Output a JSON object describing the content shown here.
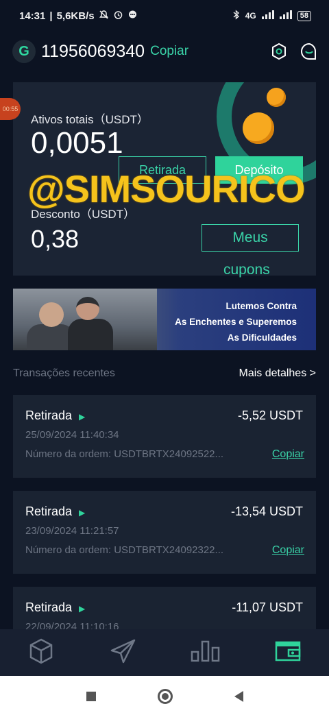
{
  "status_bar": {
    "time": "14:31",
    "speed": "5,6KB/s",
    "network": "4G",
    "battery": "58"
  },
  "header": {
    "logo_letter": "G",
    "account": "11956069340",
    "copy_label": "Copiar"
  },
  "timer_badge": "00:55",
  "balance": {
    "total_label": "Ativos totais（USDT）",
    "total_value": "0,0051",
    "withdraw_label": "Retirada",
    "deposit_label": "Depósito",
    "discount_label": "Desconto（USDT）",
    "discount_value": "0,38",
    "coupons_label_line1": "Meus",
    "coupons_label_line2": "cupons"
  },
  "watermark": "@SIMSOURICO",
  "banner": {
    "line1": "Lutemos Contra",
    "line2": "As Enchentes e Superemos",
    "line3": "As Dificuldades"
  },
  "transactions_section": {
    "title": "Transações recentes",
    "more_label": "Mais detalhes >"
  },
  "transactions": [
    {
      "type": "Retirada",
      "amount": "-5,52 USDT",
      "date": "25/09/2024 11:40:34",
      "order": "Número da ordem: USDTBRTX24092522...",
      "copy_label": "Copiar"
    },
    {
      "type": "Retirada",
      "amount": "-13,54 USDT",
      "date": "23/09/2024 11:21:57",
      "order": "Número da ordem: USDTBRTX24092322...",
      "copy_label": "Copiar"
    },
    {
      "type": "Retirada",
      "amount": "-11,07 USDT",
      "date": "22/09/2024 11:10:16"
    }
  ],
  "bottom_nav": [
    "cube-icon",
    "paper-plane-icon",
    "bar-chart-icon",
    "wallet-icon"
  ],
  "colors": {
    "background": "#0c1322",
    "card": "#1a2332",
    "accent": "#3ad3a8",
    "watermark": "#f5c31c"
  }
}
